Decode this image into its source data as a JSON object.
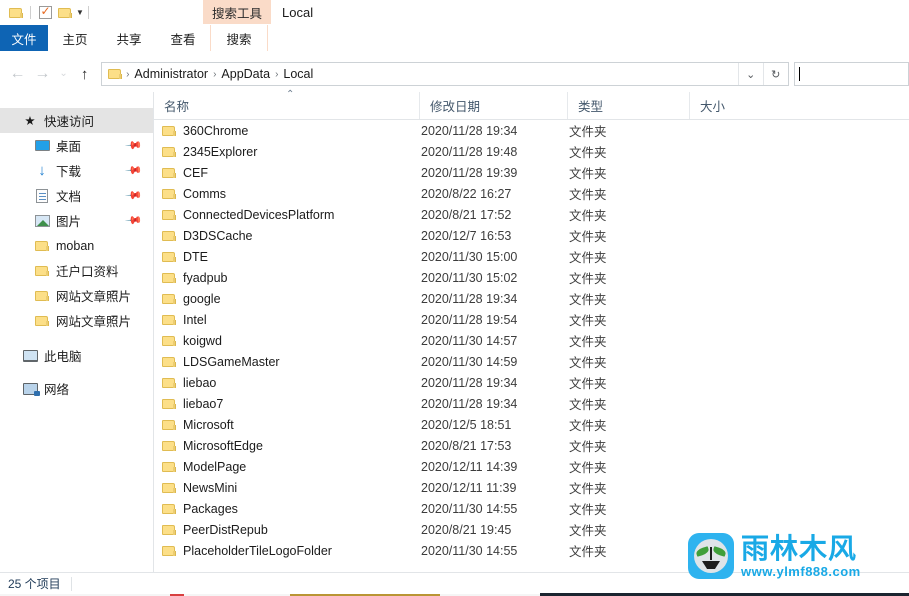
{
  "window": {
    "title": "Local",
    "contextual_tab": "搜索工具"
  },
  "quick_access_toolbar": {
    "items": [
      {
        "name": "folder-icon",
        "label": ""
      },
      {
        "name": "properties-icon",
        "label": ""
      },
      {
        "name": "new-folder-icon",
        "label": ""
      }
    ],
    "customize_caret": "▼"
  },
  "ribbon": {
    "tabs": [
      {
        "label": "文件",
        "state": "selected"
      },
      {
        "label": "主页",
        "state": "normal"
      },
      {
        "label": "共享",
        "state": "normal"
      },
      {
        "label": "查看",
        "state": "normal"
      },
      {
        "label": "搜索",
        "state": "contextual"
      }
    ]
  },
  "address_bar": {
    "back": "←",
    "forward": "→",
    "recent": "⌄",
    "up": "↑",
    "breadcrumbs": [
      "Administrator",
      "AppData",
      "Local"
    ],
    "separator": "›",
    "dropdown": "⌄",
    "refresh": "↻"
  },
  "search": {
    "value": "",
    "placeholder": ""
  },
  "sidebar": {
    "items": [
      {
        "label": "快速访问",
        "icon": "star-icon",
        "indent": 0,
        "selected": true,
        "pinned": false
      },
      {
        "label": "桌面",
        "icon": "desktop-icon",
        "indent": 1,
        "selected": false,
        "pinned": true
      },
      {
        "label": "下载",
        "icon": "download-icon",
        "indent": 1,
        "selected": false,
        "pinned": true
      },
      {
        "label": "文档",
        "icon": "document-icon",
        "indent": 1,
        "selected": false,
        "pinned": true
      },
      {
        "label": "图片",
        "icon": "pictures-icon",
        "indent": 1,
        "selected": false,
        "pinned": true
      },
      {
        "label": "moban",
        "icon": "folder-icon",
        "indent": 1,
        "selected": false,
        "pinned": false
      },
      {
        "label": "迁户口资料",
        "icon": "folder-icon",
        "indent": 1,
        "selected": false,
        "pinned": false
      },
      {
        "label": "网站文章照片",
        "icon": "folder-icon",
        "indent": 1,
        "selected": false,
        "pinned": false
      },
      {
        "label": "网站文章照片",
        "icon": "folder-icon",
        "indent": 1,
        "selected": false,
        "pinned": false
      },
      {
        "label": "此电脑",
        "icon": "this-pc-icon",
        "indent": 0,
        "selected": false,
        "pinned": false
      },
      {
        "label": "网络",
        "icon": "network-icon",
        "indent": 0,
        "selected": false,
        "pinned": false
      }
    ],
    "pin_glyph": "📌"
  },
  "file_list": {
    "columns": [
      {
        "label": "名称",
        "key": "name"
      },
      {
        "label": "修改日期",
        "key": "date"
      },
      {
        "label": "类型",
        "key": "type"
      },
      {
        "label": "大小",
        "key": "size"
      }
    ],
    "sort": {
      "column": "名称",
      "direction": "asc",
      "glyph": "⌃"
    },
    "rows": [
      {
        "name": "360Chrome",
        "date": "2020/11/28 19:34",
        "type": "文件夹",
        "size": ""
      },
      {
        "name": "2345Explorer",
        "date": "2020/11/28 19:48",
        "type": "文件夹",
        "size": ""
      },
      {
        "name": "CEF",
        "date": "2020/11/28 19:39",
        "type": "文件夹",
        "size": ""
      },
      {
        "name": "Comms",
        "date": "2020/8/22 16:27",
        "type": "文件夹",
        "size": ""
      },
      {
        "name": "ConnectedDevicesPlatform",
        "date": "2020/8/21 17:52",
        "type": "文件夹",
        "size": ""
      },
      {
        "name": "D3DSCache",
        "date": "2020/12/7 16:53",
        "type": "文件夹",
        "size": ""
      },
      {
        "name": "DTE",
        "date": "2020/11/30 15:00",
        "type": "文件夹",
        "size": ""
      },
      {
        "name": "fyadpub",
        "date": "2020/11/30 15:02",
        "type": "文件夹",
        "size": ""
      },
      {
        "name": "google",
        "date": "2020/11/28 19:34",
        "type": "文件夹",
        "size": ""
      },
      {
        "name": "Intel",
        "date": "2020/11/28 19:54",
        "type": "文件夹",
        "size": ""
      },
      {
        "name": "koigwd",
        "date": "2020/11/30 14:57",
        "type": "文件夹",
        "size": ""
      },
      {
        "name": "LDSGameMaster",
        "date": "2020/11/30 14:59",
        "type": "文件夹",
        "size": ""
      },
      {
        "name": "liebao",
        "date": "2020/11/28 19:34",
        "type": "文件夹",
        "size": ""
      },
      {
        "name": "liebao7",
        "date": "2020/11/28 19:34",
        "type": "文件夹",
        "size": ""
      },
      {
        "name": "Microsoft",
        "date": "2020/12/5 18:51",
        "type": "文件夹",
        "size": ""
      },
      {
        "name": "MicrosoftEdge",
        "date": "2020/8/21 17:53",
        "type": "文件夹",
        "size": ""
      },
      {
        "name": "ModelPage",
        "date": "2020/12/11 14:39",
        "type": "文件夹",
        "size": ""
      },
      {
        "name": "NewsMini",
        "date": "2020/12/11 11:39",
        "type": "文件夹",
        "size": ""
      },
      {
        "name": "Packages",
        "date": "2020/11/30 14:55",
        "type": "文件夹",
        "size": ""
      },
      {
        "name": "PeerDistRepub",
        "date": "2020/8/21 19:45",
        "type": "文件夹",
        "size": ""
      },
      {
        "name": "PlaceholderTileLogoFolder",
        "date": "2020/11/30 14:55",
        "type": "文件夹",
        "size": ""
      }
    ]
  },
  "status_bar": {
    "item_count": "25 个项目"
  },
  "watermark": {
    "brand": "雨林木风",
    "url": "www.ylmf888.com"
  },
  "colors": {
    "accent_blue": "#0e64b4",
    "contextual_peach": "#fadbc8",
    "folder_yellow": "#fcdf88",
    "watermark_blue": "#19a9e6",
    "selection_gray": "#e4e4e4"
  }
}
